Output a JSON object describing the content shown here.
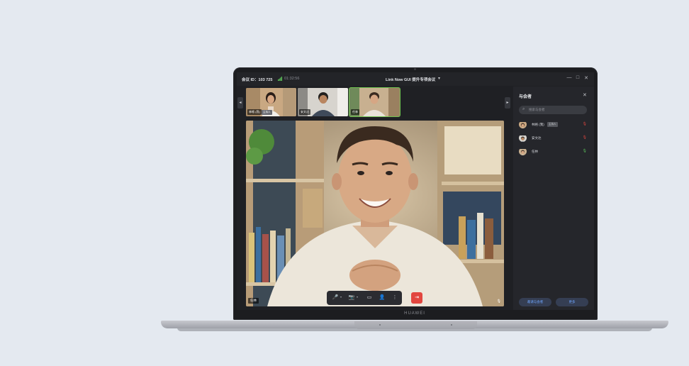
{
  "titlebar": {
    "meeting_id": "会议 ID：103 725",
    "duration": "01:32:56",
    "title": "Link Now GUI 提升专项会议",
    "caret": "▾",
    "controls": [
      "—",
      "□",
      "✕"
    ]
  },
  "strip": {
    "prev_arrow": "◂",
    "next_arrow": "▸",
    "thumbs": [
      {
        "label": "林格 (我)",
        "tag": "主持人",
        "active": false
      },
      {
        "label": "安文达",
        "active": false
      },
      {
        "label": "任林",
        "active": true
      }
    ]
  },
  "main": {
    "speaker_label": "任林",
    "mic_icon": "🎙"
  },
  "controls": {
    "mic": "🎤",
    "camera": "📷",
    "share": "▭",
    "participants": "👤",
    "more": "⋮",
    "leave": "⇥",
    "caret": "▾"
  },
  "sidebar": {
    "title": "与会者",
    "close": "✕",
    "search_placeholder": "搜索与会者",
    "participants": [
      {
        "name": "林格 (我)",
        "tag": "主持人",
        "mic_color": "#e2463f"
      },
      {
        "name": "安文达",
        "mic_color": "#e2463f"
      },
      {
        "name": "任林",
        "mic_color": "#5cc15a"
      }
    ],
    "invite_button": "邀请与会者",
    "more_button": "更多"
  },
  "laptop": {
    "brand": "HUAWEI"
  }
}
